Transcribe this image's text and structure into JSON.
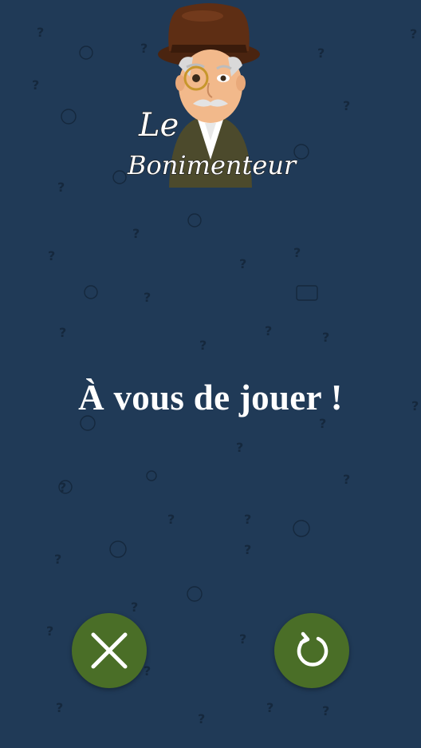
{
  "logo": {
    "line1": "Le",
    "line2": "Bonimenteur"
  },
  "main": {
    "title": "À vous de jouer !"
  },
  "actions": {
    "close_icon": "close-x-icon",
    "restart_icon": "restart-icon"
  },
  "colors": {
    "background": "#203a57",
    "button": "#4a6e27",
    "text": "#ffffff"
  }
}
